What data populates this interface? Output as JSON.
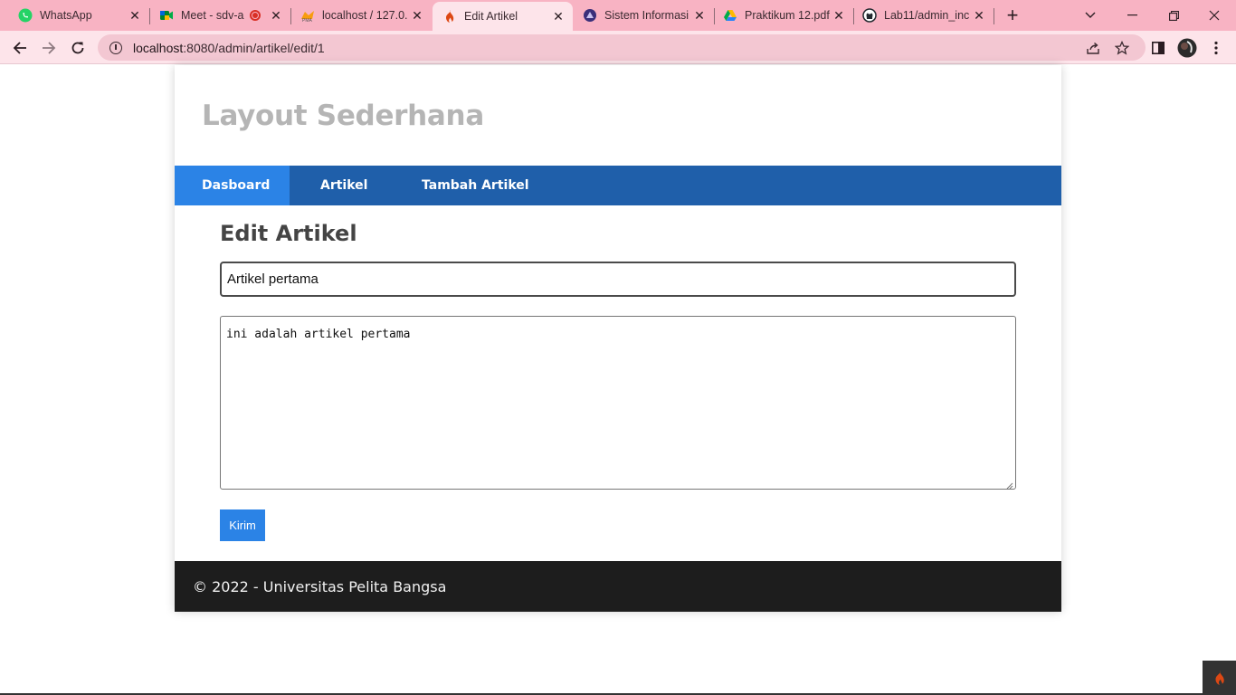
{
  "browser": {
    "tabs": [
      {
        "title": "WhatsApp",
        "icon": "whatsapp-icon"
      },
      {
        "title": "Meet - sdv-a",
        "icon": "google-meet-icon"
      },
      {
        "title": "localhost / 127.0.",
        "icon": "phpmyadmin-icon"
      },
      {
        "title": "Edit Artikel",
        "icon": "codeigniter-icon",
        "active": true
      },
      {
        "title": "Sistem Informasi",
        "icon": "university-icon"
      },
      {
        "title": "Praktikum 12.pdf",
        "icon": "google-drive-icon"
      },
      {
        "title": "Lab11/admin_inc",
        "icon": "github-icon"
      }
    ],
    "url_host": "localhost",
    "url_rest": ":8080/admin/artikel/edit/1",
    "accent_color": "#f8b3c3"
  },
  "site": {
    "title": "Layout Sederhana",
    "nav": [
      {
        "label": "Dasboard",
        "active": true
      },
      {
        "label": "Artikel"
      },
      {
        "label": "Tambah Artikel"
      }
    ],
    "colors": {
      "nav": "#1f5faa",
      "nav_active": "#2b83e6",
      "footer": "#1d1d1d"
    }
  },
  "form": {
    "heading": "Edit Artikel",
    "title_value": "Artikel pertama",
    "body_value": "ini adalah artikel pertama",
    "submit_label": "Kirim"
  },
  "footer": {
    "text": "© 2022 - Universitas Pelita Bangsa"
  }
}
